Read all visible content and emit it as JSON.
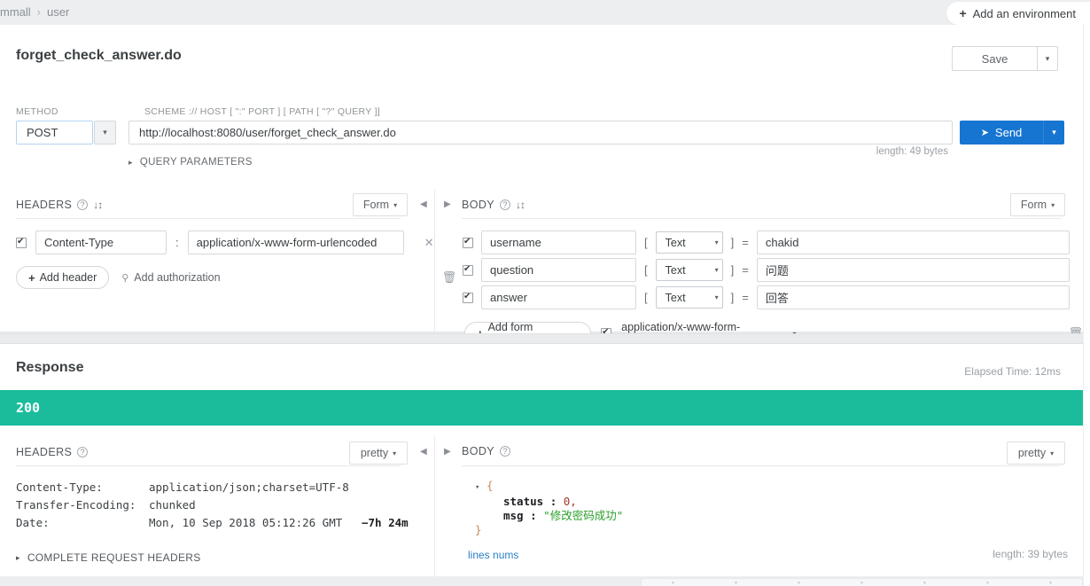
{
  "topbar": {
    "breadcrumb": [
      "mmall",
      "user"
    ],
    "breadcrumb_sep": "›",
    "environment_button": "Add an environment",
    "plus": "+"
  },
  "request": {
    "title": "forget_check_answer.do",
    "save_label": "Save",
    "caret": "▾",
    "method_label": "METHOD",
    "method_value": "POST",
    "url_label": "SCHEME :// HOST [ \":\" PORT ] [ PATH [ \"?\" QUERY ]]",
    "url_value": "http://localhost:8080/user/forget_check_answer.do",
    "send_label": "Send",
    "send_icon": "➤",
    "length_note": "length: 49 bytes",
    "query_parameters_label": "QUERY PARAMETERS",
    "query_parameters_arrow": "▸",
    "headers": {
      "title": "HEADERS",
      "help_icon": "?",
      "sort_icon": "↓↕",
      "mode": "Form",
      "collapse_arrow": "◀",
      "rows": [
        {
          "checked": true,
          "key": "Content-Type",
          "separator": ":",
          "value": "application/x-www-form-urlencoded",
          "remove": "✕"
        }
      ],
      "add_header_label": "Add header",
      "add_authorization_label": "Add authorization",
      "auth_icon": "🔑",
      "trash_icon": "🗑",
      "plus": "+"
    },
    "body": {
      "title": "BODY",
      "help_icon": "?",
      "sort_icon": "↓↕",
      "mode": "Form",
      "collapse_arrow": "▶",
      "bracket_open": "[",
      "bracket_close": "]",
      "equals": "=",
      "rows": [
        {
          "checked": true,
          "name": "username",
          "type": "Text",
          "value": "chakid",
          "remove": "✕"
        },
        {
          "checked": true,
          "name": "question",
          "type": "Text",
          "value": "问题",
          "remove": "✕"
        },
        {
          "checked": true,
          "name": "answer",
          "type": "Text",
          "value": "回答",
          "remove": "✕"
        }
      ],
      "add_form_parameter_label": "Add form parameter",
      "content_type_checked": true,
      "content_type_value": "application/x-www-form-urlencoded",
      "content_type_caret": "▾",
      "trash_icon": "🗑",
      "plus": "+"
    }
  },
  "response": {
    "title": "Response",
    "elapsed": "Elapsed Time: 12ms",
    "status_code": "200",
    "status_color": "#1abc9c",
    "headers": {
      "title": "HEADERS",
      "help_icon": "?",
      "mode": "pretty",
      "collapse_arrow": "◀",
      "rows": [
        {
          "key": "Content-Type:",
          "value": "application/json;charset=UTF-8"
        },
        {
          "key": "Transfer-Encoding:",
          "value": "chunked"
        },
        {
          "key": "Date:",
          "value": "Mon, 10 Sep 2018 05:12:26 GMT",
          "offset": "−7h 24m"
        }
      ],
      "complete_request_headers": "COMPLETE REQUEST HEADERS",
      "complete_arrow": "▸"
    },
    "body": {
      "title": "BODY",
      "help_icon": "?",
      "mode": "pretty",
      "collapse_arrow": "▶",
      "toggle": "▾",
      "open_brace": "{",
      "close_brace": "}",
      "entries": [
        {
          "key": "status",
          "colon": ":",
          "value": "0,",
          "kind": "number"
        },
        {
          "key": "msg",
          "colon": ":",
          "value": "\"修改密码成功\"",
          "kind": "string"
        }
      ],
      "lines_nums_label": "lines nums",
      "length_note": "length: 39 bytes"
    }
  }
}
